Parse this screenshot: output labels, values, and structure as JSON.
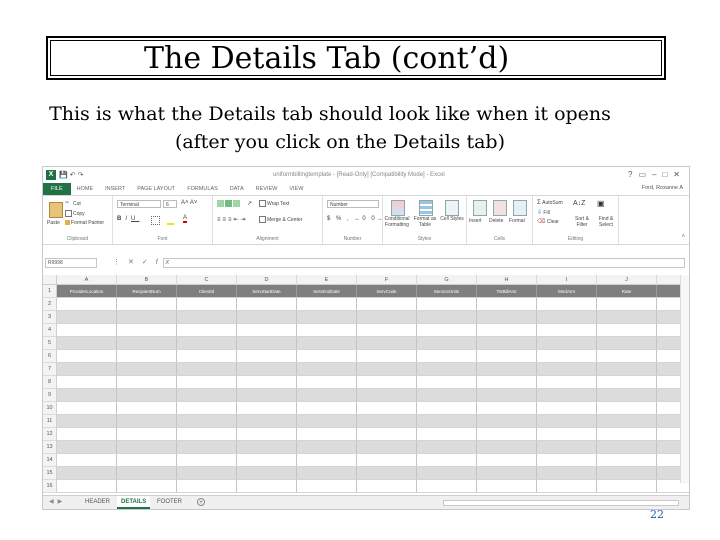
{
  "slide": {
    "title": "The Details Tab (cont’d)",
    "subtitle_line1": "This is what the Details tab should look like when it opens",
    "subtitle_line2": "(after you click on the Details tab)",
    "page_number": "22"
  },
  "excel": {
    "doc_title": "uniformbillingtemplate - [Read-Only] [Compatibility Mode] - Excel",
    "user": "Ford, Roxanne A",
    "tabs": [
      "FILE",
      "HOME",
      "INSERT",
      "PAGE LAYOUT",
      "FORMULAS",
      "DATA",
      "REVIEW",
      "VIEW"
    ],
    "ribbon": {
      "cut": "Cut",
      "copy": "Copy",
      "format_painter": "Format Painter",
      "paste": "Paste",
      "font_name": "Terminal",
      "font_size": "6",
      "wrap_text": "Wrap Text",
      "merge_center": "Merge & Center",
      "number_format": "Number",
      "conditional_formatting": "Conditional Formatting",
      "format_as_table": "Format as Table",
      "cell_styles": "Cell Styles",
      "insert": "Insert",
      "delete": "Delete",
      "format": "Format",
      "autosum": "AutoSum",
      "fill": "Fill",
      "clear": "Clear",
      "sort_filter": "Sort & Filter",
      "find_select": "Find & Select",
      "groups": [
        "Clipboard",
        "Font",
        "Alignment",
        "Number",
        "Styles",
        "Cells",
        "Editing"
      ]
    },
    "name_box": "R9998",
    "fx_label": "fx",
    "columns": [
      "A",
      "B",
      "C",
      "D",
      "E",
      "F",
      "G",
      "H",
      "I",
      "J"
    ],
    "header_cells": [
      "ProviderLocation",
      "RecipientNum",
      "ClientId",
      "ServStartDate",
      "ServEndDate",
      "ServCode",
      "ServiceUnits",
      "TotBillAmt",
      "MedAmt",
      "Rate"
    ],
    "row_numbers": [
      "1",
      "2",
      "3",
      "4",
      "5",
      "6",
      "7",
      "8",
      "9",
      "10",
      "11",
      "12",
      "13",
      "14",
      "15",
      "16"
    ],
    "sheet_tabs": [
      "HEADER",
      "DETAILS",
      "FOOTER"
    ],
    "active_sheet": "DETAILS"
  }
}
